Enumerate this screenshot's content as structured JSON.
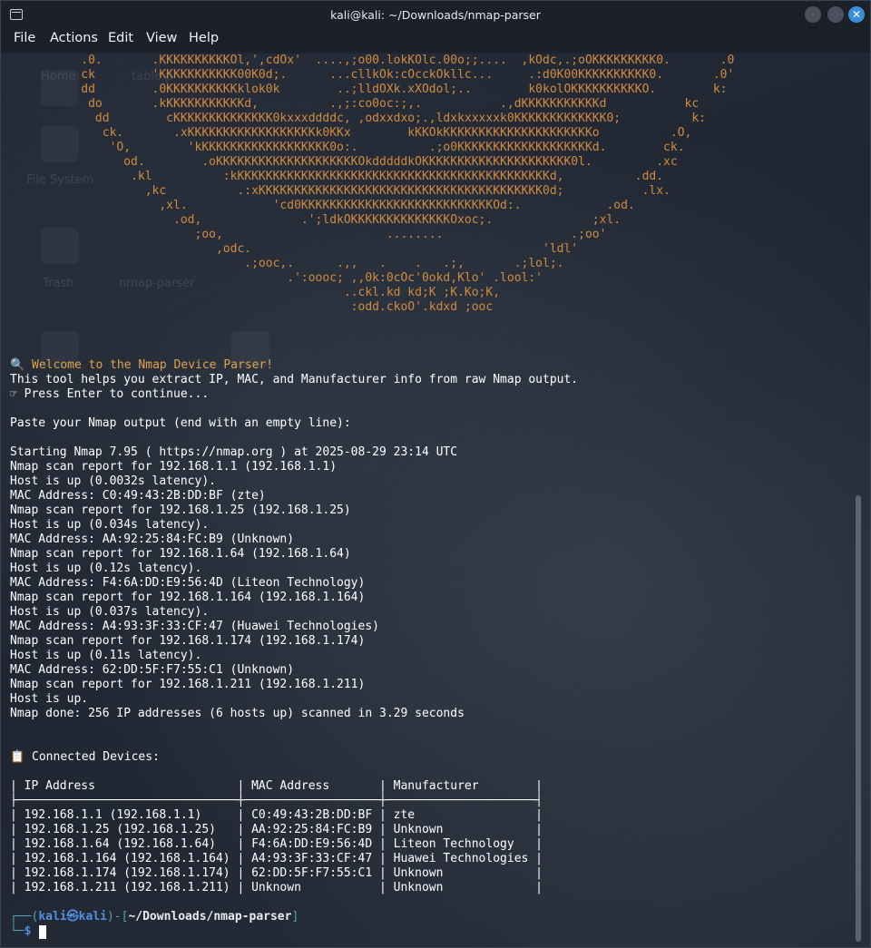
{
  "window": {
    "title": "kali@kali: ~/Downloads/nmap-parser"
  },
  "menu": [
    "File",
    "Actions",
    "Edit",
    "View",
    "Help"
  ],
  "desktop_labels": [
    "Home",
    "table.p",
    "File System",
    "Trash",
    "nmap-parser"
  ],
  "art_lines": [
    "          .0.       .KKKKKKKKKKOl,',cdOx'  ....,;o00.lokKOlc.00o;;....  ,kOdc,.;oOKKKKKKKKK0.       .0",
    "          ck        'KKKKKKKKKKK00K0d;.      ...cllkOk:cOcckOkllc...     .:d0K00KKKKKKKKKK0.       .0'",
    "          dd        .0KKKKKKKKKKklok0k        ..;lldOXk.xXOdol;..        k0kolOKKKKKKKKKKO.        k:",
    "           do       .kKKKKKKKKKKKd,          .,;:co0oc:;,.           .,dKKKKKKKKKKKd           kc",
    "            dd        cKKKKKKKKKKKKKK0kxxxddddc, ,odxxdxo;.,ldxkxxxxxk0KKKKKKKKKKKKK0;          k:",
    "             ck.       .xKKKKKKKKKKKKKKKKKKk0KKx        kKKOkKKKKKKKKKKKKKKKKKKKKKo          .O,",
    "              'O,        'kKKKKKKKKKKKKKKKKKK0o:.          .;o0KKKKKKKKKKKKKKKKKKKd.        ck.",
    "                od.        .oKKKKKKKKKKKKKKKKKKKKOkdddddkOKKKKKKKKKKKKKKKKKKKKK0l.         .xc",
    "                 .kl          :kKKKKKKKKKKKKKKKKKKKKKKKKKKKKKKKKKKKKKKKKKKKKd,          .dd.",
    "                   ,kc          .:xKKKKKKKKKKKKKKKKKKKKKKKKKKKKKKKKKKKKKKKK0d;           .lx.",
    "                     ,xl.            'cd0KKKKKKKKKKKKKKKKKKKKKKKKKKKOd:.            .od.",
    "                       .od,              .';ldkOKKKKKKKKKKKKKKOxoc;.              ;xl.",
    "                          ;oo,                       ........                  .;oo'",
    "                             ,odc.                                         'ldl'",
    "                                 .;ooc,.      .,,   .    .   .;,       .;lol;.",
    "                                       .':oooc; ,,0k:0cOc'0okd,Klo' .lool:'",
    "                                               ..ckl.kd kd;K ;K.Ko;K,",
    "                                                :odd.ckoO'.kdxd ;ooc"
  ],
  "intro": {
    "welcome": "🔍 Welcome to the Nmap Device Parser!",
    "description": "This tool helps you extract IP, MAC, and Manufacturer info from raw Nmap output.",
    "continue": "☞ Press Enter to continue...",
    "paste_prompt": "Paste your Nmap output (end with an empty line):"
  },
  "nmap_output": [
    "Starting Nmap 7.95 ( https://nmap.org ) at 2025-08-29 23:14 UTC",
    "Nmap scan report for 192.168.1.1 (192.168.1.1)",
    "Host is up (0.0032s latency).",
    "MAC Address: C0:49:43:2B:DD:BF (zte)",
    "Nmap scan report for 192.168.1.25 (192.168.1.25)",
    "Host is up (0.034s latency).",
    "MAC Address: AA:92:25:84:FC:B9 (Unknown)",
    "Nmap scan report for 192.168.1.64 (192.168.1.64)",
    "Host is up (0.12s latency).",
    "MAC Address: F4:6A:DD:E9:56:4D (Liteon Technology)",
    "Nmap scan report for 192.168.1.164 (192.168.1.164)",
    "Host is up (0.037s latency).",
    "MAC Address: A4:93:3F:33:CF:47 (Huawei Technologies)",
    "Nmap scan report for 192.168.1.174 (192.168.1.174)",
    "Host is up (0.11s latency).",
    "MAC Address: 62:DD:5F:F7:55:C1 (Unknown)",
    "Nmap scan report for 192.168.1.211 (192.168.1.211)",
    "Host is up.",
    "Nmap done: 256 IP addresses (6 hosts up) scanned in 3.29 seconds"
  ],
  "devices_heading": "📋 Connected Devices:",
  "table": {
    "headers": [
      "IP Address",
      "MAC Address",
      "Manufacturer"
    ],
    "rows": [
      [
        "192.168.1.1 (192.168.1.1)",
        "C0:49:43:2B:DD:BF",
        "zte"
      ],
      [
        "192.168.1.25 (192.168.1.25)",
        "AA:92:25:84:FC:B9",
        "Unknown"
      ],
      [
        "192.168.1.64 (192.168.1.64)",
        "F4:6A:DD:E9:56:4D",
        "Liteon Technology"
      ],
      [
        "192.168.1.164 (192.168.1.164)",
        "A4:93:3F:33:CF:47",
        "Huawei Technologies"
      ],
      [
        "192.168.1.174 (192.168.1.174)",
        "62:DD:5F:F7:55:C1",
        "Unknown"
      ],
      [
        "192.168.1.211 (192.168.1.211)",
        "Unknown",
        "Unknown"
      ]
    ]
  },
  "prompt": {
    "user": "kali",
    "at": "㉿",
    "host": "kali",
    "path": "~/Downloads/nmap-parser",
    "symbol": "$"
  },
  "colors": {
    "art": "#d28a3e",
    "welcome": "#e2a14b",
    "prompt_user": "#4f8fe0",
    "prompt_frame": "#4fa3b8",
    "close_button": "#3b8fd9"
  }
}
